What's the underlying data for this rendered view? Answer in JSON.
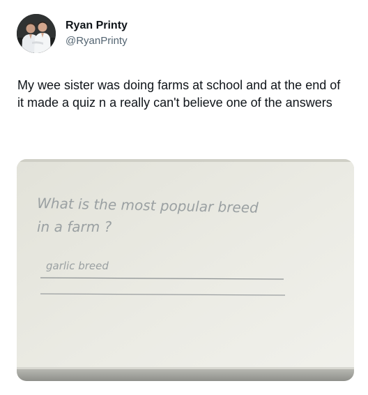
{
  "author": {
    "display_name": "Ryan Printy",
    "handle": "@RyanPrinty",
    "avatar_icon": "profile-photo-two-men-icon"
  },
  "tweet": {
    "text": "My wee sister was doing farms at school and at the end of it made a quiz n a really can't believe one of the answers"
  },
  "media": {
    "question_line_1": "What is the most popular breed",
    "question_line_2": "in a farm ?",
    "answer": "garlic breed"
  }
}
